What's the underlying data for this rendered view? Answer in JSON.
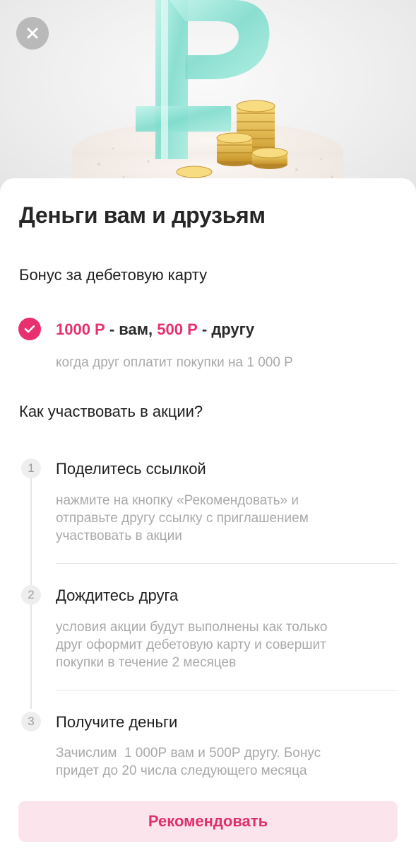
{
  "hero": {
    "close_icon": "close-icon",
    "illustration": "ruble-sign-with-coins"
  },
  "sheet": {
    "title": "Деньги вам и друзьям",
    "subtitle": "Бонус за дебетовую карту",
    "bonus": {
      "icon": "check-icon",
      "amount_you": "1000 Р",
      "text_you": " - вам, ",
      "amount_friend": "500 Р",
      "text_friend": " - другу",
      "note": "когда друг оплатит покупки на 1 000 Р"
    },
    "how_title": "Как участвовать в акции?",
    "steps": [
      {
        "number": "1",
        "title": "Поделитесь ссылкой",
        "desc_lines": [
          "нажмите на кнопку «Рекомендовать» и",
          "отправьте другу ссылку с приглашением",
          "участвовать в акции"
        ]
      },
      {
        "number": "2",
        "title": "Дождитесь друга",
        "desc_lines": [
          "условия акции будут выполнены как только",
          "друг оформит дебетовую карту и совершит",
          "покупки в течение 2 месяцев"
        ]
      },
      {
        "number": "3",
        "title": "Получите деньги",
        "desc_lines": [
          "Зачислим  1 000Р вам и 500Р другу. Бонус",
          "придет до 20 числа следующего месяца"
        ]
      }
    ],
    "cta_label": "Рекомендовать"
  },
  "colors": {
    "accent": "#e8306f",
    "cta_bg": "#fce4ec",
    "muted": "#a9a9a9"
  }
}
